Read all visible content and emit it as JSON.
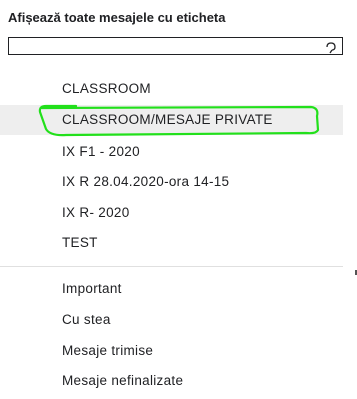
{
  "heading": "Afișează toate mesajele cu eticheta",
  "search": {
    "value": "",
    "placeholder": ""
  },
  "labels": [
    "CLASSROOM",
    "CLASSROOM/MESAJE PRIVATE",
    "IX F1 - 2020",
    "IX R 28.04.2020-ora 14-15",
    "IX R- 2020",
    "TEST"
  ],
  "system_labels": [
    "Important",
    "Cu stea",
    "Mesaje trimise",
    "Mesaje nefinalizate"
  ],
  "selected_label_index": 1,
  "colors": {
    "annotation": "#22e01b",
    "selected_bg": "#eeeeee",
    "text": "#202124"
  }
}
